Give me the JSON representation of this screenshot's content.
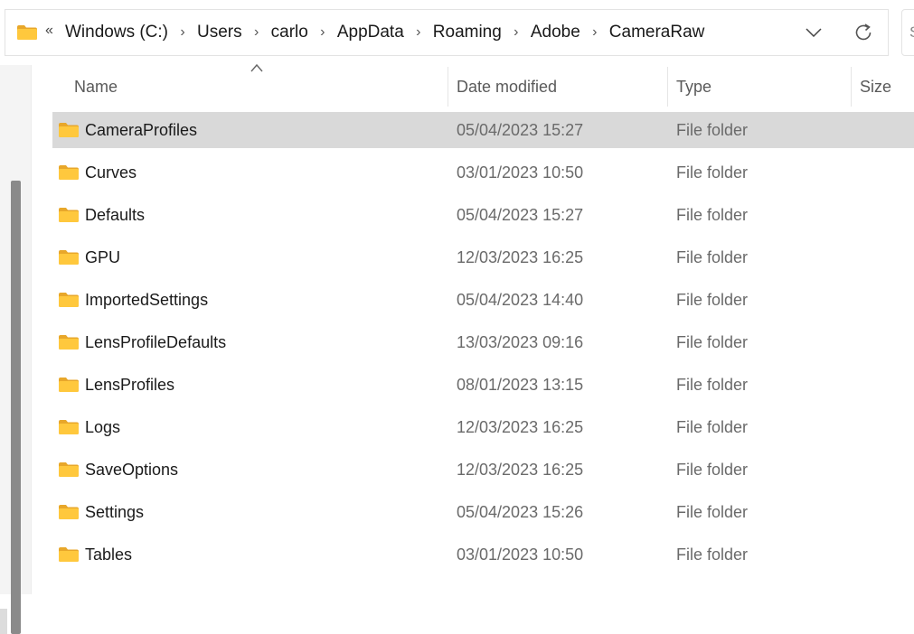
{
  "address_bar": {
    "overflow_label": "«",
    "breadcrumbs": [
      "Windows (C:)",
      "Users",
      "carlo",
      "AppData",
      "Roaming",
      "Adobe",
      "CameraRaw"
    ],
    "separator": "›",
    "history_icon": "chevron-down-icon",
    "refresh_icon": "refresh-icon"
  },
  "search": {
    "partial_text": "S"
  },
  "columns": {
    "name": "Name",
    "date_modified": "Date modified",
    "type": "Type",
    "size": "Size"
  },
  "files": [
    {
      "name": "CameraProfiles",
      "date": "05/04/2023 15:27",
      "type": "File folder",
      "selected": true
    },
    {
      "name": "Curves",
      "date": "03/01/2023 10:50",
      "type": "File folder",
      "selected": false
    },
    {
      "name": "Defaults",
      "date": "05/04/2023 15:27",
      "type": "File folder",
      "selected": false
    },
    {
      "name": "GPU",
      "date": "12/03/2023 16:25",
      "type": "File folder",
      "selected": false
    },
    {
      "name": "ImportedSettings",
      "date": "05/04/2023 14:40",
      "type": "File folder",
      "selected": false
    },
    {
      "name": "LensProfileDefaults",
      "date": "13/03/2023 09:16",
      "type": "File folder",
      "selected": false
    },
    {
      "name": "LensProfiles",
      "date": "08/01/2023 13:15",
      "type": "File folder",
      "selected": false
    },
    {
      "name": "Logs",
      "date": "12/03/2023 16:25",
      "type": "File folder",
      "selected": false
    },
    {
      "name": "SaveOptions",
      "date": "12/03/2023 16:25",
      "type": "File folder",
      "selected": false
    },
    {
      "name": "Settings",
      "date": "05/04/2023 15:26",
      "type": "File folder",
      "selected": false
    },
    {
      "name": "Tables",
      "date": "03/01/2023 10:50",
      "type": "File folder",
      "selected": false
    }
  ],
  "colors": {
    "folder_fill": "#ffc83d",
    "folder_tab": "#e8a72a",
    "selection": "#d9d9d9",
    "scrollbar": "#8a8a8a"
  }
}
